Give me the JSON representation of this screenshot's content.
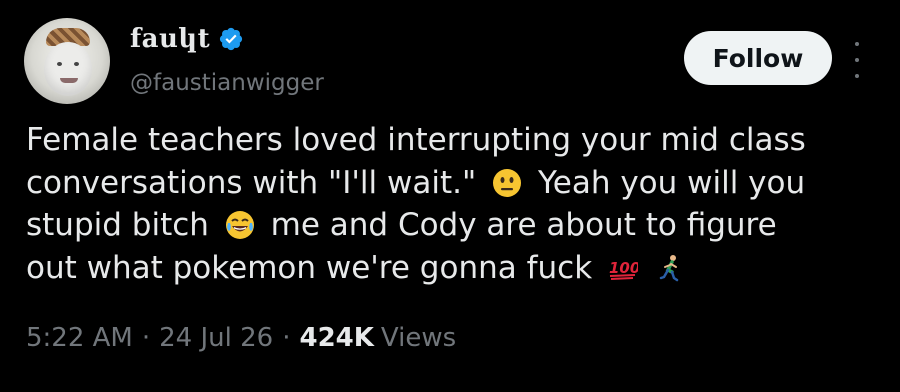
{
  "author": {
    "display_name": "fauկt",
    "handle": "@faustianwigger",
    "verified": true
  },
  "follow_button": {
    "label": "Follow"
  },
  "tweet": {
    "lines": [
      {
        "parts": [
          "Female teachers loved interrupting your mid class"
        ]
      },
      {
        "parts": [
          "conversations with \"I'll wait.\"",
          "Yeah you will you"
        ]
      },
      {
        "parts": [
          "stupid bitch",
          "me and Cody are about to figure"
        ]
      },
      {
        "parts": [
          "out what pokemon we're gonna fuck"
        ]
      }
    ],
    "emojis": [
      "neutral-face-emoji",
      "tears-of-joy-emoji",
      "hundred-points-emoji",
      "running-person-emoji"
    ]
  },
  "meta": {
    "time": "5:22 AM",
    "date": "24 Jul 26",
    "views_count": "424K",
    "views_label": "Views",
    "separator": "·"
  },
  "colors": {
    "background": "#000000",
    "text_primary": "#e7e9ea",
    "text_secondary": "#71767b",
    "verified_blue": "#1d9bf0",
    "button_bg": "#eff3f4"
  }
}
